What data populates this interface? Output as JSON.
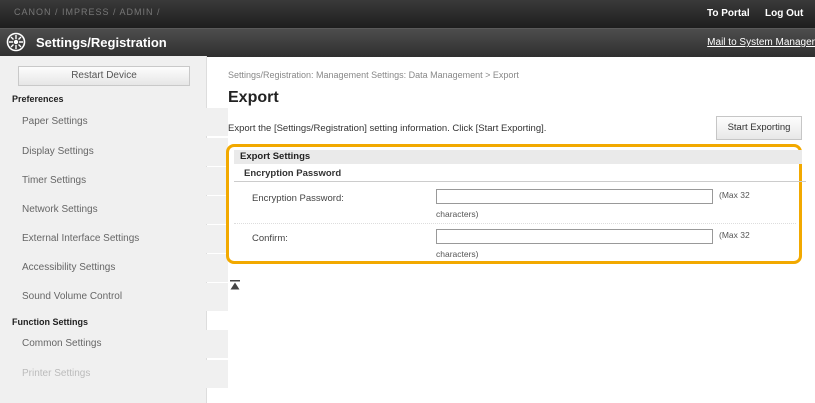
{
  "topbar": {
    "device_name": "CANON / IMPRESS / ADMIN /",
    "portal_link": "To Portal",
    "logout_link": "Log Out"
  },
  "titlebar": {
    "logo_icon": "settings-registration-icon",
    "title": "Settings/Registration",
    "mail_link": "Mail to System Manager"
  },
  "sidebar": {
    "restart_button": "Restart Device",
    "preferences_heading": "Preferences",
    "preferences_items": [
      "Paper Settings",
      "Display Settings",
      "Timer Settings",
      "Network Settings",
      "External Interface Settings",
      "Accessibility Settings",
      "Sound Volume Control"
    ],
    "function_heading": "Function Settings",
    "function_items": [
      "Common Settings",
      "Printer Settings"
    ]
  },
  "main": {
    "breadcrumb": "Settings/Registration: Management Settings: Data Management > Export",
    "page_title": "Export",
    "description": "Export the [Settings/Registration] setting information. Click [Start Exporting].",
    "start_button": "Start Exporting",
    "export_settings_heading": "Export Settings",
    "encryption_heading": "Encryption Password",
    "fields": [
      {
        "label": "Encryption Password:",
        "value": "",
        "hint_a": "(Max 32",
        "hint_b": "characters)"
      },
      {
        "label": "Confirm:",
        "value": "",
        "hint_a": "(Max 32",
        "hint_b": "characters)"
      }
    ],
    "highlight_color": "#f2a900",
    "to_top_icon": "to-top-icon"
  }
}
